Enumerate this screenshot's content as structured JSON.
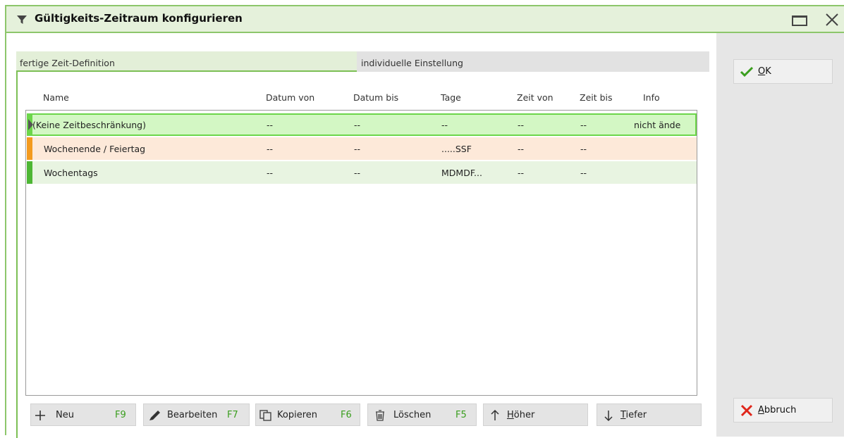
{
  "window": {
    "title": "Gültigkeits-Zeitraum konfigurieren"
  },
  "tabs": [
    {
      "label": "fertige Zeit-Definition",
      "active": true
    },
    {
      "label": "individuelle Einstellung",
      "active": false
    }
  ],
  "columns": [
    "Name",
    "Datum von",
    "Datum bis",
    "Tage",
    "Zeit von",
    "Zeit bis",
    "Info"
  ],
  "rows": [
    {
      "name": "(Keine Zeitbeschränkung)",
      "datum_von": "--",
      "datum_bis": "--",
      "tage": "--",
      "zeit_von": "--",
      "zeit_bis": "--",
      "info": "nicht ände",
      "color": "#6cd64a",
      "selected": true
    },
    {
      "name": "Wochenende / Feiertag",
      "datum_von": "--",
      "datum_bis": "--",
      "tage": ".....SSF",
      "zeit_von": "--",
      "zeit_bis": "--",
      "info": "",
      "color": "#f39a1e"
    },
    {
      "name": "Wochentags",
      "datum_von": "--",
      "datum_bis": "--",
      "tage": "MDMDF...",
      "zeit_von": "--",
      "zeit_bis": "--",
      "info": "",
      "color": "#4db634"
    }
  ],
  "toolbar": {
    "neu": {
      "label": "Neu",
      "key": "F9"
    },
    "bearbeiten": {
      "label": "Bearbeiten",
      "key": "F7"
    },
    "kopieren": {
      "label": "Kopieren",
      "key": "F6"
    },
    "loeschen": {
      "label": "Löschen",
      "key": "F5"
    },
    "hoeher": {
      "label_first": "H",
      "label_rest": "öher"
    },
    "tiefer": {
      "label_first": "T",
      "label_rest": "iefer"
    }
  },
  "side": {
    "ok": {
      "label_first": "O",
      "label_rest": "K"
    },
    "abbruch": {
      "label_first": "A",
      "label_rest": "bbruch"
    }
  },
  "colors": {
    "accent_green": "#7cbf55",
    "title_bg": "#e5f1db",
    "key_green": "#3a9e1e",
    "cancel_red": "#e0261b"
  },
  "icons": [
    "filter-icon",
    "maximize-icon",
    "close-icon",
    "check-icon",
    "cross-icon",
    "plus-icon",
    "pencil-icon",
    "copy-icon",
    "trash-icon",
    "arrow-up-icon",
    "arrow-down-icon",
    "row-pointer-icon"
  ]
}
